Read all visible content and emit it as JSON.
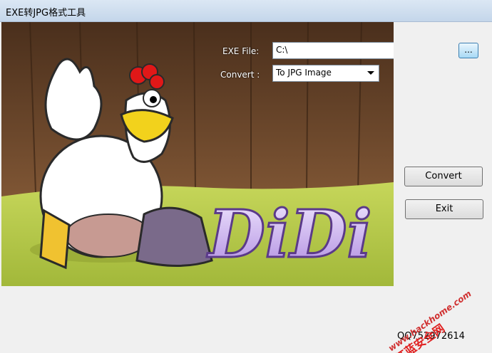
{
  "window": {
    "title": "EXE转JPG格式工具"
  },
  "form": {
    "exe_label": "EXE File:",
    "exe_value": "C:\\",
    "browse_label": "...",
    "convert_label": "Convert :",
    "convert_selected": "To JPG Image"
  },
  "actions": {
    "convert": "Convert",
    "exit": "Exit"
  },
  "footer": {
    "qq": "QQ752972614"
  },
  "image": {
    "logo_text": "DiDi",
    "watermark_site": "www.hackhome.com",
    "watermark_brand": "红蓝安全网"
  },
  "colors": {
    "title_bar": "#c4d6ea",
    "background": "#f0f0f0",
    "browse_button": "#a7d9f5"
  }
}
